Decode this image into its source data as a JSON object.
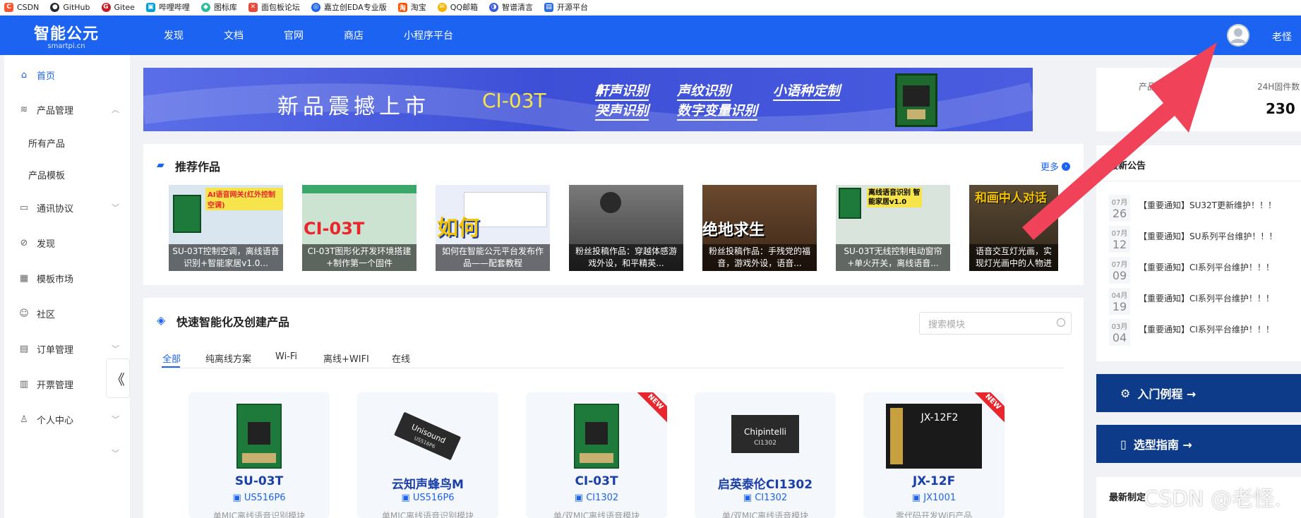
{
  "bookmarks": [
    {
      "label": "CSDN",
      "icon": "csdn-icon",
      "color": "#fc5531"
    },
    {
      "label": "GitHub",
      "icon": "github-icon",
      "color": "#24292f"
    },
    {
      "label": "Gitee",
      "icon": "gitee-icon",
      "color": "#c71d23"
    },
    {
      "label": "哔哩哔哩",
      "icon": "bilibili-icon",
      "color": "#00a1d6"
    },
    {
      "label": "图标库",
      "icon": "iconfont-icon",
      "color": "#2ebc9a"
    },
    {
      "label": "面包板论坛",
      "icon": "breadboard-icon",
      "color": "#e84a3a"
    },
    {
      "label": "嘉立创EDA专业版",
      "icon": "lceda-icon",
      "color": "#1b63f0"
    },
    {
      "label": "淘宝",
      "icon": "taobao-icon",
      "color": "#ff5000"
    },
    {
      "label": "QQ邮箱",
      "icon": "qqmail-icon",
      "color": "#f5b400"
    },
    {
      "label": "智谱清言",
      "icon": "zhipu-icon",
      "color": "#3b5bdb"
    },
    {
      "label": "开源平台",
      "icon": "opensource-icon",
      "color": "#2f6fe0"
    }
  ],
  "header": {
    "logo_main": "智能公元",
    "logo_sub": "smartpi.cn",
    "nav": [
      "发现",
      "文档",
      "官网",
      "商店",
      "小程序平台"
    ],
    "username": "老怪",
    "brand_color": "#1b63f0"
  },
  "sidebar": {
    "items": [
      {
        "label": "首页",
        "icon": "home-icon",
        "active": true
      },
      {
        "label": "产品管理",
        "icon": "layers-icon",
        "expanded": true
      },
      {
        "label": "所有产品",
        "sub": true
      },
      {
        "label": "产品模板",
        "sub": true
      },
      {
        "label": "通讯协议",
        "icon": "protocol-icon"
      },
      {
        "label": "发现",
        "icon": "compass-icon"
      },
      {
        "label": "模板市场",
        "icon": "grid-icon"
      },
      {
        "label": "社区",
        "icon": "smile-icon"
      },
      {
        "label": "订单管理",
        "icon": "order-icon"
      },
      {
        "label": "开票管理",
        "icon": "invoice-icon"
      },
      {
        "label": "个人中心",
        "icon": "user-icon"
      }
    ],
    "collapse": "《"
  },
  "banner": {
    "title": "新品震撼上市",
    "model": "CI-03T",
    "tags": [
      "鼾声识别",
      "声纹识别",
      "小语种定制",
      "哭声识别",
      "数字变量识别"
    ]
  },
  "recommended": {
    "title": "推荐作品",
    "more": "更多",
    "works": [
      {
        "caption": "SU-03T控制空调，离线语音识别+智能家居v1.0...",
        "overlay": "AI语音网关(红外控制空调)",
        "color": "#d9e6ef"
      },
      {
        "caption": "CI-03T图形化开发环境搭建+制作第一个固件",
        "overlay": "CI-03T",
        "color": "#cde3d2"
      },
      {
        "caption": "如何在智能公元平台发布作品——配套教程",
        "overlay": "如何",
        "color": "#3a6fd8"
      },
      {
        "caption": "粉丝投稿作品：穿越体感游戏外设，和平精英...",
        "overlay": "",
        "color": "#555"
      },
      {
        "caption": "粉丝投稿作品：手残党的福音，游戏外设，语音...",
        "overlay": "绝地求生",
        "color": "#6b4a2e"
      },
      {
        "caption": "SU-03T无线控制电动窗帘+单火开关，离线语音...",
        "overlay": "离线语音识别 智能家居v1.0",
        "color": "#d8e4dc"
      },
      {
        "caption": "语音交互灯光画，实现灯光画中的人物进行...",
        "overlay": "和画中人对话",
        "color": "#4a3a2a"
      }
    ]
  },
  "quick": {
    "title": "快速智能化及创建产品",
    "search_placeholder": "搜索模块",
    "tabs": [
      "全部",
      "纯离线方案",
      "Wi-Fi",
      "离线+WIFI",
      "在线"
    ],
    "active_tab": "全部",
    "products": [
      {
        "name": "SU-03T",
        "chip": "US516P6",
        "desc": "单MIC离线语音识别模块",
        "new": false,
        "chip_label": ""
      },
      {
        "name": "云知声蜂鸟M",
        "chip": "US516P6",
        "desc": "单MIC离线语音识别模块",
        "new": false,
        "chip_label": "Unisound"
      },
      {
        "name": "CI-03T",
        "chip": "CI1302",
        "desc": "单/双MIC离线语音模块",
        "new": true,
        "chip_label": ""
      },
      {
        "name": "启英泰伦CI1302",
        "chip": "CI1302",
        "desc": "单/双MIC离线语音模块",
        "new": false,
        "chip_label": "Chipintelli"
      },
      {
        "name": "JX-12F",
        "chip": "JX1001",
        "desc": "零代码开发WiFi产品",
        "new": true,
        "chip_label": "JX-12F2"
      }
    ],
    "new_label": "NEW"
  },
  "stats": {
    "label_a": "产品",
    "label_b": "24H固件数",
    "value_b": "230"
  },
  "notices": {
    "title": "最新公告",
    "items": [
      {
        "month": "07月",
        "day": "26",
        "text": "【重要通知】SU32T更新维护！！！"
      },
      {
        "month": "07月",
        "day": "12",
        "text": "【重要通知】SU系列平台维护！！！"
      },
      {
        "month": "07月",
        "day": "09",
        "text": "【重要通知】CI系列平台维护！！！"
      },
      {
        "month": "04月",
        "day": "19",
        "text": "【重要通知】CI系列平台维护！！！"
      },
      {
        "month": "03月",
        "day": "04",
        "text": "【重要通知】CI系列平台维护！！！"
      }
    ]
  },
  "guides": [
    {
      "label": "入门例程 →",
      "icon": "rocket-icon"
    },
    {
      "label": "选型指南 →",
      "icon": "book-icon"
    }
  ],
  "latest": {
    "title": "最新制定"
  },
  "watermark": "CSDN @老怪.",
  "arrow_color": "#f0435a"
}
